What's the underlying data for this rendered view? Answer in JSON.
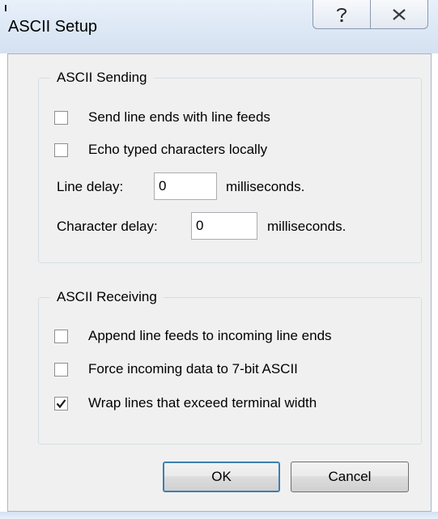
{
  "window": {
    "title": "ASCII Setup",
    "help_icon": "help-icon",
    "close_icon": "close-icon"
  },
  "sending": {
    "group_label": "ASCII Sending",
    "send_line_ends": {
      "label": "Send line ends with line feeds",
      "checked": false
    },
    "echo_typed": {
      "label": "Echo typed characters locally",
      "checked": false
    },
    "line_delay": {
      "label": "Line delay:",
      "value": "0",
      "unit": "milliseconds."
    },
    "character_delay": {
      "label": "Character delay:",
      "value": "0",
      "unit": "milliseconds."
    }
  },
  "receiving": {
    "group_label": "ASCII Receiving",
    "append_line_feeds": {
      "label": "Append line feeds to incoming line ends",
      "checked": false
    },
    "force_7bit": {
      "label": "Force incoming data to 7-bit ASCII",
      "checked": false
    },
    "wrap_lines": {
      "label": "Wrap lines that exceed terminal width",
      "checked": true
    }
  },
  "buttons": {
    "ok": "OK",
    "cancel": "Cancel"
  }
}
